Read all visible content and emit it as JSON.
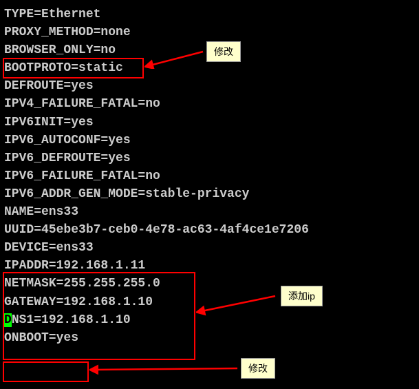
{
  "config": {
    "lines": [
      "TYPE=Ethernet",
      "PROXY_METHOD=none",
      "BROWSER_ONLY=no",
      "BOOTPROTO=static",
      "DEFROUTE=yes",
      "IPV4_FAILURE_FATAL=no",
      "IPV6INIT=yes",
      "IPV6_AUTOCONF=yes",
      "IPV6_DEFROUTE=yes",
      "IPV6_FAILURE_FATAL=no",
      "IPV6_ADDR_GEN_MODE=stable-privacy",
      "NAME=ens33",
      "UUID=45ebe3b7-ceb0-4e78-ac63-4af4ce1e7206",
      "DEVICE=ens33",
      "IPADDR=192.168.1.11",
      "NETMASK=255.255.255.0",
      "GATEWAY=192.168.1.10",
      "DNS1=192.168.1.10",
      "ONBOOT=yes"
    ]
  },
  "annotations": {
    "modify1": "修改",
    "addip": "添加ip",
    "modify2": "修改"
  },
  "cursor_line": 17,
  "cursor_char": "D"
}
